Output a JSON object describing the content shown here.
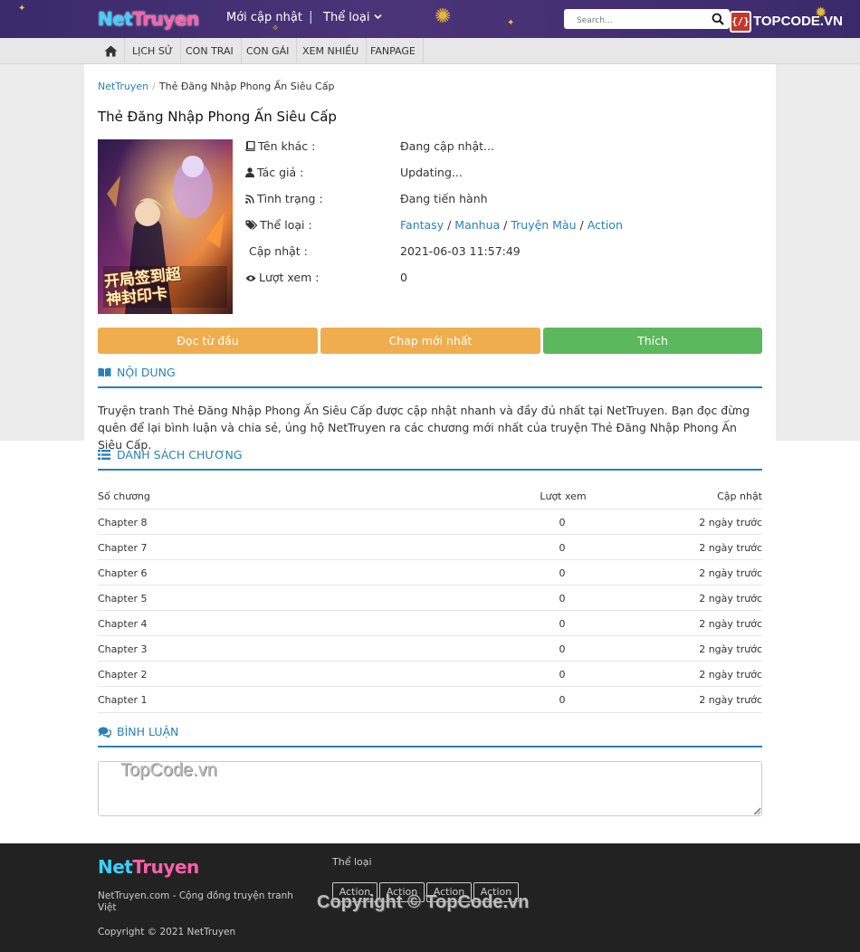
{
  "header": {
    "logo": {
      "part1": "Net",
      "part2": "Truyen"
    },
    "links": [
      "Mới cập nhật",
      "Thể loại"
    ],
    "separator": "|",
    "search_placeholder": "Search...",
    "brand_box": "{/}",
    "brand_text": "TOPCODE.VN"
  },
  "nav": {
    "items": [
      "LỊCH SỬ",
      "CON TRAI",
      "CON GÁI",
      "XEM NHIỀU",
      "FANPAGE"
    ]
  },
  "breadcrumb": {
    "home": "NetTruyen",
    "sep": "/",
    "current": "Thẻ Đăng Nhập Phong Ấn Siêu Cấp"
  },
  "comic": {
    "title": "Thẻ Đăng Nhập Phong Ấn Siêu Cấp",
    "info": [
      {
        "label": "Tên khác :",
        "value": "Đang cập nhật..."
      },
      {
        "label": "Tác giả :",
        "value": "Updating..."
      },
      {
        "label": "Tình trạng :",
        "value": "Đang tiến hành"
      },
      {
        "label": "Thể loại :",
        "value": ""
      },
      {
        "label": "Cập nhật :",
        "value": "2021-06-03 11:57:49"
      },
      {
        "label": "Lượt xem :",
        "value": "0"
      }
    ],
    "categories": [
      "Fantasy",
      "Manhua",
      "Truyện Màu",
      "Action"
    ],
    "cover_text": "开局签到超神封印卡"
  },
  "buttons": {
    "read_first": "Đọc từ đầu",
    "latest": "Chap mới nhất",
    "like": "Thích"
  },
  "sections": {
    "content": "NỘI DUNG",
    "chapters": "DANH SÁCH CHƯƠNG",
    "comments": "BÌNH LUẬN"
  },
  "description": "Truyện tranh Thẻ Đăng Nhập Phong Ấn Siêu Cấp được cập nhật nhanh và đầy đủ nhất tại NetTruyen. Bạn đọc đừng quên để lại bình luận và chia sẻ, ủng hộ NetTruyen ra các chương mới nhất của truyện Thẻ Đăng Nhập Phong Ấn Siêu Cấp.",
  "chapter_table": {
    "headers": [
      "Số chương",
      "Lượt xem",
      "Cập nhật"
    ],
    "rows": [
      {
        "name": "Chapter 8",
        "views": "0",
        "updated": "2 ngày trước"
      },
      {
        "name": "Chapter 7",
        "views": "0",
        "updated": "2 ngày trước"
      },
      {
        "name": "Chapter 6",
        "views": "0",
        "updated": "2 ngày trước"
      },
      {
        "name": "Chapter 5",
        "views": "0",
        "updated": "2 ngày trước"
      },
      {
        "name": "Chapter 4",
        "views": "0",
        "updated": "2 ngày trước"
      },
      {
        "name": "Chapter 3",
        "views": "0",
        "updated": "2 ngày trước"
      },
      {
        "name": "Chapter 2",
        "views": "0",
        "updated": "2 ngày trước"
      },
      {
        "name": "Chapter 1",
        "views": "0",
        "updated": "2 ngày trước"
      }
    ]
  },
  "watermarks": {
    "comment": "TopCode.vn",
    "footer": "Copyright © TopCode.vn"
  },
  "footer": {
    "logo": {
      "part1": "Net",
      "part2": "Truyen"
    },
    "tagline": "NetTruyen.com - Cộng đồng truyện tranh Việt",
    "copyright": "Copyright © 2021 NetTruyen",
    "category_title": "Thể loại",
    "tags": [
      "Action",
      "Action",
      "Action",
      "Action"
    ]
  },
  "colors": {
    "header_bg": "#3a2a6b",
    "link": "#2980b9",
    "btn_orange": "#f0ad4e",
    "btn_green": "#5cb85c",
    "footer_bg": "#222222"
  }
}
